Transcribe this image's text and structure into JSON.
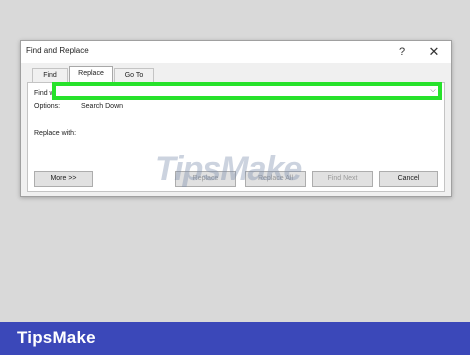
{
  "dialog": {
    "title": "Find and Replace",
    "help_label": "?",
    "close_label": "✕",
    "tabs": [
      {
        "label": "Find"
      },
      {
        "label": "Replace"
      },
      {
        "label": "Go To"
      }
    ],
    "find_label": "Find what:",
    "find_value": "",
    "options_label": "Options:",
    "options_value": "Search Down",
    "replace_label": "Replace with:",
    "replace_value": "",
    "dropdown_glyph": "⌵",
    "buttons": {
      "more": "More >>",
      "replace": "Replace",
      "replace_all": "Replace All",
      "find_next": "Find Next",
      "cancel": "Cancel"
    }
  },
  "watermark": "TipsMake",
  "banner": {
    "brand": "TipsMake"
  },
  "colors": {
    "highlight": "#27e22b",
    "banner": "#3b48b9"
  }
}
